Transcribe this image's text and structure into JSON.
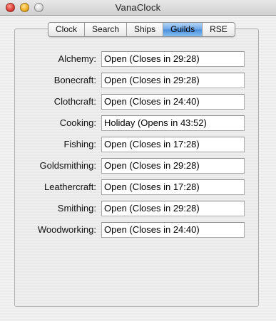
{
  "window": {
    "title": "VanaClock"
  },
  "tabs": [
    {
      "label": "Clock",
      "active": false
    },
    {
      "label": "Search",
      "active": false
    },
    {
      "label": "Ships",
      "active": false
    },
    {
      "label": "Guilds",
      "active": true
    },
    {
      "label": "RSE",
      "active": false
    }
  ],
  "guilds": [
    {
      "label": "Alchemy:",
      "status": "Open (Closes in 29:28)"
    },
    {
      "label": "Bonecraft:",
      "status": "Open (Closes in 29:28)"
    },
    {
      "label": "Clothcraft:",
      "status": "Open (Closes in 24:40)"
    },
    {
      "label": "Cooking:",
      "status": "Holiday (Opens in 43:52)"
    },
    {
      "label": "Fishing:",
      "status": "Open (Closes in 17:28)"
    },
    {
      "label": "Goldsmithing:",
      "status": "Open (Closes in 29:28)"
    },
    {
      "label": "Leathercraft:",
      "status": "Open (Closes in 17:28)"
    },
    {
      "label": "Smithing:",
      "status": "Open (Closes in 29:28)"
    },
    {
      "label": "Woodworking:",
      "status": "Open (Closes in 24:40)"
    }
  ],
  "colors": {
    "active_tab": "#6aa6e6",
    "close_button": "#e0443a",
    "minimize_button": "#f2b224",
    "zoom_button": "#d9d9d9"
  }
}
